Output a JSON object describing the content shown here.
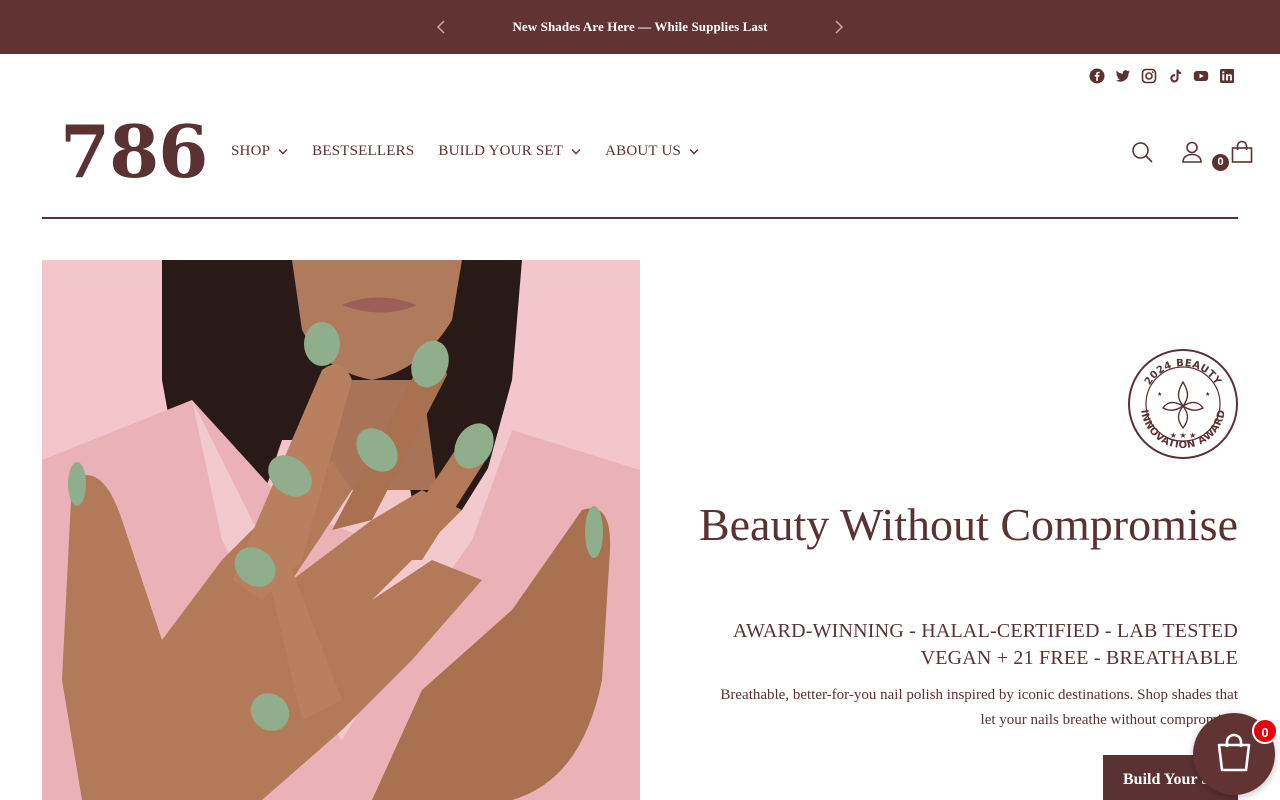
{
  "announcement": {
    "message": "New Shades Are Here — While Supplies Last",
    "prev_icon": "chevron-left-icon",
    "next_icon": "chevron-right-icon"
  },
  "social": {
    "icons": [
      "facebook-icon",
      "twitter-icon",
      "instagram-icon",
      "tiktok-icon",
      "youtube-icon",
      "linkedin-icon"
    ]
  },
  "header": {
    "logo": "786",
    "nav": [
      {
        "label": "SHOP",
        "has_dropdown": true
      },
      {
        "label": "BESTSELLERS",
        "has_dropdown": false
      },
      {
        "label": "BUILD YOUR SET",
        "has_dropdown": true
      },
      {
        "label": "ABOUT US",
        "has_dropdown": true
      }
    ],
    "icons": [
      "search-icon",
      "account-icon",
      "cart-icon"
    ],
    "cart_count": "0"
  },
  "hero": {
    "badge_text": "2024 BEAUTY INNOVATION AWARD",
    "title": "Beauty Without Compromise",
    "subhead_line1": "AWARD-WINNING - HALAL-CERTIFIED - LAB TESTED",
    "subhead_line2": "VEGAN + 21 FREE - BREATHABLE",
    "description": "Breathable, better-for-you nail polish inspired by iconic destinations. Shop shades that let your nails breathe without compromise.",
    "cta_label": "Build Your Set"
  },
  "floating_cart": {
    "count": "0"
  },
  "colors": {
    "brand": "#623333",
    "text": "#5b3232",
    "hero_bg": "#f2c6cb",
    "polish": "#8fae8b",
    "alert": "#e8000b"
  }
}
